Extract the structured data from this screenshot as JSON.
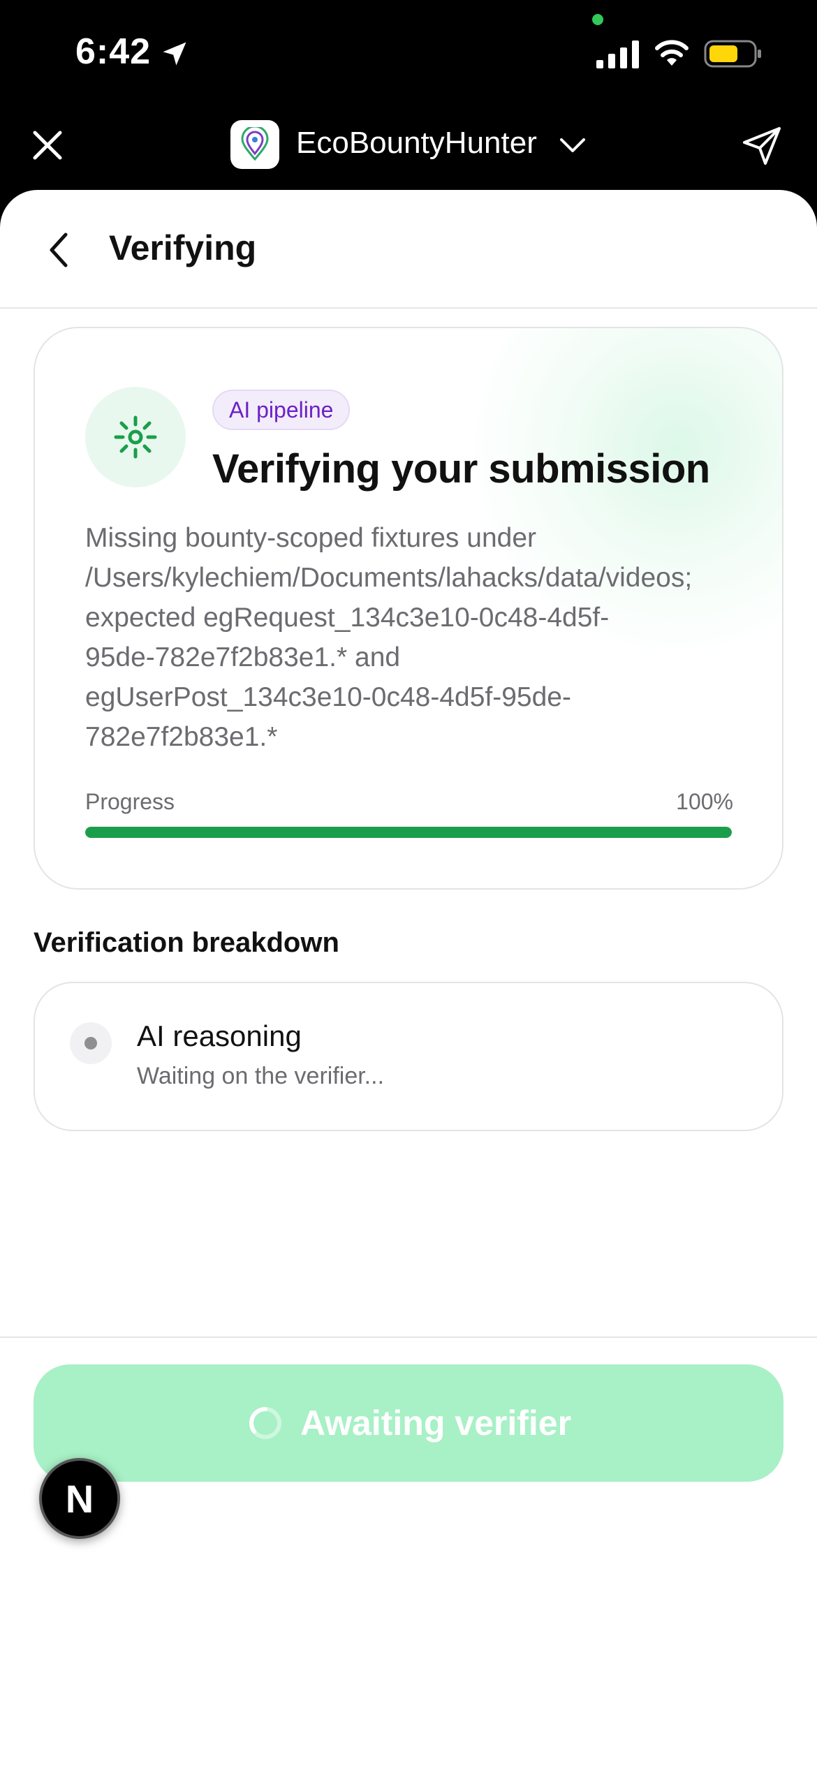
{
  "status_bar": {
    "time": "6:42",
    "battery_color": "#ffd60a",
    "icons": [
      "location-arrow-icon",
      "signal-icon",
      "wifi-icon",
      "battery-icon"
    ]
  },
  "app_bar": {
    "app_name": "EcoBountyHunter",
    "icons": [
      "close-icon",
      "app-logo-icon",
      "chevron-down-icon",
      "send-icon"
    ]
  },
  "nav": {
    "title": "Verifying"
  },
  "status_card": {
    "badge": "AI pipeline",
    "title": "Verifying your submission",
    "description": "Missing bounty-scoped fixtures under\n/Users/kylechiem/Documents/lahacks/data/videos;\nexpected egRequest_134c3e10-0c48-4d5f-\n95de-782e7f2b83e1.* and\negUserPost_134c3e10-0c48-4d5f-95de-\n782e7f2b83e1.*",
    "progress_label": "Progress",
    "progress_text": "100%",
    "progress_value": 100,
    "accent_color": "#1b9e4b",
    "badge_color": "#6b21c8"
  },
  "breakdown": {
    "title": "Verification breakdown",
    "steps": [
      {
        "title": "AI reasoning",
        "subtitle": "Waiting on the verifier..."
      }
    ]
  },
  "footer": {
    "button_label": "Awaiting verifier",
    "button_color": "#a8f0c6",
    "badge_letter": "N"
  }
}
